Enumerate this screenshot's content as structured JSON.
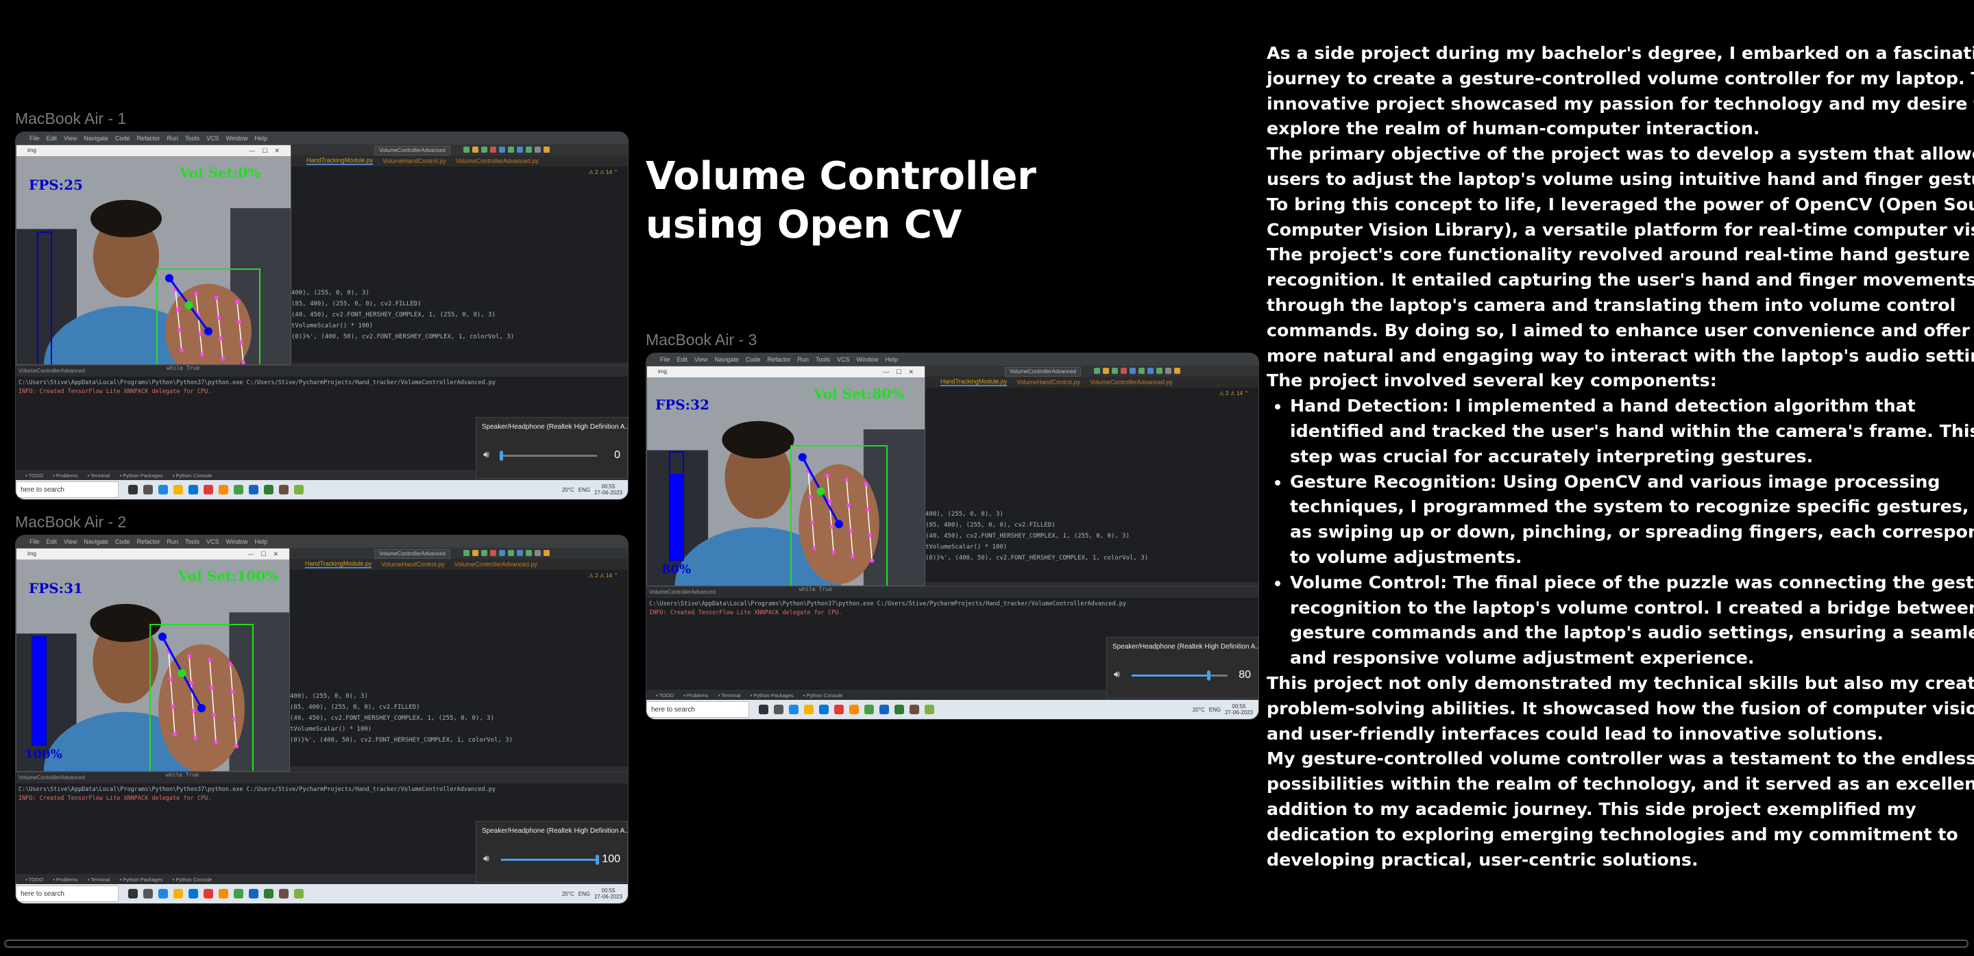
{
  "frames": [
    {
      "label": "MacBook Air - 1",
      "fps": "FPS:25",
      "vol_set": "Vol Set:0%",
      "vol_pct": "0%",
      "level": 0.0,
      "speaker_device": "Speaker/Headphone (Realtek High Definition A...",
      "volume_value": "0"
    },
    {
      "label": "MacBook Air - 2",
      "fps": "FPS:31",
      "vol_set": "Vol Set:100%",
      "vol_pct": "100%",
      "level": 1.0,
      "speaker_device": "Speaker/Headphone (Realtek High Definition A...",
      "volume_value": "100"
    },
    {
      "label": "MacBook Air - 3",
      "fps": "FPS:32",
      "vol_set": "Vol Set:80%",
      "vol_pct": "80%",
      "level": 0.8,
      "speaker_device": "Speaker/Headphone (Realtek High Definition A...",
      "volume_value": "80"
    }
  ],
  "ide": {
    "menu": [
      "File",
      "Edit",
      "View",
      "Navigate",
      "Code",
      "Refactor",
      "Run",
      "Tools",
      "VCS",
      "Window",
      "Help"
    ],
    "tabs": [
      "HandTrackingModule.py",
      "VolumeHandControl.py",
      "VolumeControllerAdvanced.py"
    ],
    "run_config": "VolumeControllerAdvanced",
    "window_title": "img",
    "code_lines": [
      "400), (255, 0, 0), 3)",
      "(85, 400), (255, 0, 0), cv2.FILLED)",
      "(40, 450), cv2.FONT_HERSHEY_COMPLEX, 1, (255, 0, 0), 3)",
      "tVolumeScalar() * 100)",
      "(0)}%', (400, 50), cv2.FONT_HERSHEY_COMPLEX, 1, colorVol, 3)"
    ],
    "run_tab": "VolumeControllerAdvanced",
    "run_command": "C:\\Users\\Stive\\AppData\\Local\\Programs\\Python\\Python37\\python.exe C:/Users/Stive/PycharmProjects/Hand_tracker/VolumeControllerAdvanced.py",
    "run_info": "INFO: Created TensorFlow Lite XNNPACK delegate for CPU.",
    "bottom_tabs": [
      "TODO",
      "Problems",
      "Terminal",
      "Python Packages",
      "Python Console"
    ],
    "while_true": "while True"
  },
  "taskbar": {
    "search_placeholder": "here to search",
    "temperature": "20°C",
    "language": "ENG",
    "time": "00:55",
    "date": "27-06-2023"
  },
  "project": {
    "title": "Volume Controller using Open CV",
    "intro": "As a side project during my bachelor's degree, I embarked on a fascinating journey to create a gesture-controlled volume controller for my laptop. This innovative project showcased my passion for technology and my desire to explore the realm of human-computer interaction.",
    "objective": "The primary objective of the project was to develop a system that allowed users to adjust the laptop's volume using intuitive hand and finger gestures. To bring this concept to life, I leveraged the power of OpenCV (Open Source Computer Vision Library), a versatile platform for real-time computer vision.",
    "core": "The project's core functionality revolved around real-time hand gesture recognition. It entailed capturing the user's hand and finger movements through the laptop's camera and translating them into volume control commands. By doing so, I aimed to enhance user convenience and offer a more natural and engaging way to interact with the laptop's audio settings.",
    "components_intro": "The project involved several key components:",
    "components": [
      "Hand Detection: I implemented a hand detection algorithm that identified and tracked the user's hand within the camera's frame. This step was crucial for accurately interpreting gestures.",
      "Gesture Recognition: Using OpenCV and various image processing techniques, I programmed the system to recognize specific gestures, such as swiping up or down, pinching, or spreading fingers, each corresponding to volume adjustments.",
      "Volume Control: The final piece of the puzzle was connecting the gesture recognition to the laptop's volume control. I created a bridge between the gesture commands and the laptop's audio settings, ensuring a seamless and responsive volume adjustment experience."
    ],
    "skills": "This project not only demonstrated my technical skills but also my creative problem-solving abilities. It showcased how the fusion of computer vision and user-friendly interfaces could lead to innovative solutions.",
    "conclusion": "My gesture-controlled volume controller was a testament to the endless possibilities within the realm of technology, and it served as an excellent addition to my academic journey. This side project exemplified my dedication to exploring emerging technologies and my commitment to developing practical, user-centric solutions."
  },
  "colors": {
    "background": "#000000",
    "fps_text": "#0000cc",
    "vol_set_text": "#22dd22",
    "hand_box": "#22dd22",
    "landmarks": "#ff44ff",
    "volume_accent": "#4a9ff0"
  }
}
